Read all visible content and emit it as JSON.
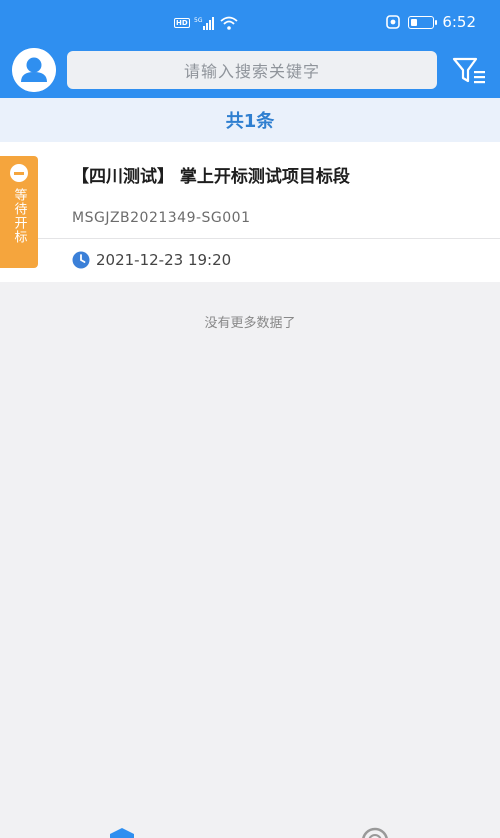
{
  "status_bar": {
    "hd_label": "HD",
    "signal_label": "5G",
    "time": "6:52"
  },
  "search": {
    "placeholder": "请输入搜索关键字"
  },
  "result_count": "共1条",
  "items": [
    {
      "status": "等待开标",
      "title": "【四川测试】 掌上开标测试项目标段",
      "code": "MSGJZB2021349-SG001",
      "datetime": "2021-12-23 19:20"
    }
  ],
  "no_more_text": "没有更多数据了",
  "colors": {
    "header_blue": "#2f8ff0",
    "status_orange": "#f5a53d",
    "count_text": "#2f7fd0"
  },
  "icons": {
    "avatar": "user-avatar-icon",
    "filter": "filter-menu-icon",
    "clock": "clock-icon",
    "status": "minus-circle-icon"
  }
}
